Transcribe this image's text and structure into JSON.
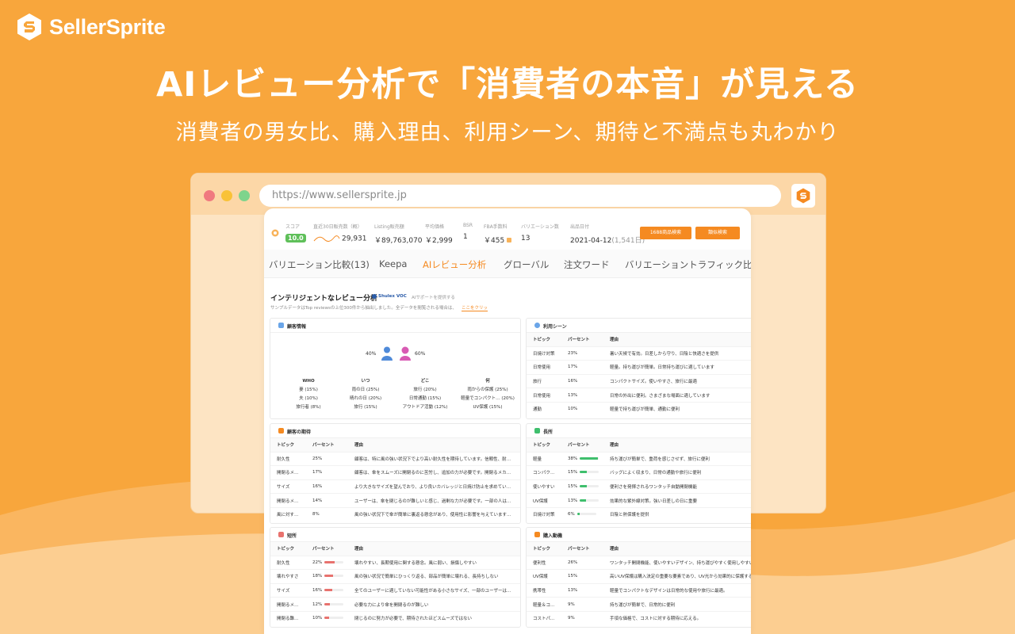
{
  "brand": {
    "name": "SellerSprite"
  },
  "headline": "AIレビュー分析で「消費者の本音」が見える",
  "subline": "消費者の男女比、購入理由、利用シーン、期待と不満点も丸わかり",
  "browser": {
    "url": "https://www.sellersprite.jp"
  },
  "stats": [
    {
      "label": "スコア",
      "value": "10.0"
    },
    {
      "label": "直近30日販売数（概）",
      "value": "29,931"
    },
    {
      "label": "Listing販売額",
      "value": "￥89,763,070"
    },
    {
      "label": "平均価格",
      "value": "￥2,999"
    },
    {
      "label": "BSR",
      "value": "1"
    },
    {
      "label": "FBA手数料",
      "value": "￥455"
    },
    {
      "label": "バリエーション数",
      "value": "13"
    },
    {
      "label": "出品日付",
      "value": "2021-04-12",
      "extra": "(1,541日)"
    }
  ],
  "buttons": {
    "search1688": "1688商品検索",
    "similar": "類似検索"
  },
  "tabs": [
    "バリエーション比較(13)",
    "Keepa",
    "AIレビュー分析",
    "グローバル",
    "注文ワード",
    "バリエーショントラフィック比較"
  ],
  "analysis": {
    "title": "インテリジェントなレビュー分析",
    "voc": "Shulex VOC",
    "voc_sub": "AIサポートを提供する",
    "note": "サンプルデータはTop reviewsの上位300件から抽出しました。全データを閲覧される場合は、",
    "note_link": "ここをクリッ"
  },
  "customer": {
    "title": "顧客情報",
    "male_pct": "40%",
    "female_pct": "60%",
    "columns": [
      {
        "head": "WHO",
        "items": [
          "妻 (15%)",
          "夫 (10%)",
          "旅行者 (8%)"
        ]
      },
      {
        "head": "いつ",
        "items": [
          "雨の日 (25%)",
          "晴れの日 (20%)",
          "旅行 (15%)"
        ]
      },
      {
        "head": "どこ",
        "items": [
          "旅行 (20%)",
          "日常通勤 (15%)",
          "アウトドア活動 (12%)"
        ]
      },
      {
        "head": "何",
        "items": [
          "雨からの保護 (25%)",
          "軽量でコンパクト… (20%)",
          "UV保護 (15%)"
        ]
      }
    ]
  },
  "usage": {
    "title": "利用シーン",
    "headers": [
      "トピック",
      "パーセント",
      "理由"
    ],
    "rows": [
      [
        "日焼け対策",
        "23%",
        "暑い天候で有効。日差しから守り、日陰と快適さを提供"
      ],
      [
        "日常使用",
        "17%",
        "軽量。持ち運びが簡単。日常持ち運びに適しています"
      ],
      [
        "旅行",
        "16%",
        "コンパクトサイズ。使いやすさ、旅行に最適"
      ],
      [
        "日常使用",
        "13%",
        "日常の外出に便利。さまざまな場面に適しています"
      ],
      [
        "通勤",
        "10%",
        "軽量で持ち運びが簡単、通勤に便利"
      ]
    ]
  },
  "expectation": {
    "title": "顧客の期待",
    "headers": [
      "トピック",
      "パーセント",
      "理由"
    ],
    "rows": [
      [
        "耐久性",
        "25%",
        "顧客は、特に風の強い状況下でより高い耐久性を期待しています。信頼性、耐…"
      ],
      [
        "開閉るメ…",
        "17%",
        "顧客は、傘をスムーズに開閉るのに苦労し、追加の力が必要です。開閉るメカ…"
      ],
      [
        "サイズ",
        "16%",
        "より大きなサイズを望んでおり、より良いカバレッジと日焼け防止を求めてい…"
      ],
      [
        "開閉るメ…",
        "14%",
        "ユーザーは、傘を閉じるのが難しいと感じ、過剰な力が必要です。一部の人は…"
      ],
      [
        "風に対す…",
        "8%",
        "風の強い状況下で傘が簡単に裏返る懸念があり、使用性に影響を与えています…"
      ]
    ]
  },
  "strengths": {
    "title": "長所",
    "headers": [
      "トピック",
      "パーセント",
      "理由"
    ],
    "rows": [
      [
        "軽量",
        "38%",
        "持ち運びが簡単で、重荷を感じさせず、旅行に便利"
      ],
      [
        "コンパク…",
        "15%",
        "バッグによく収まり、日常の通勤や旅行に便利"
      ],
      [
        "使いやすい",
        "15%",
        "便利さを発揮されるワンタッチ自動開閉機能"
      ],
      [
        "UV保護",
        "13%",
        "効果的な紫外線対策。強い日差しの日に重要"
      ],
      [
        "日焼け対策",
        "6%",
        "日陰と熱保護を提供"
      ]
    ],
    "bars": [
      0.38,
      0.15,
      0.15,
      0.13,
      0.06
    ],
    "color": "#3fbf6d"
  },
  "weaknesses": {
    "title": "短所",
    "headers": [
      "トピック",
      "パーセント",
      "理由"
    ],
    "rows": [
      [
        "耐久性",
        "22%",
        "壊れやすい、長期使用に関する懸念。風に弱い、損傷しやすい"
      ],
      [
        "壊れやすさ",
        "18%",
        "風の強い状況で簡単にひっくり返る、部品が簡単に壊れる、長持ちしない"
      ],
      [
        "サイズ",
        "16%",
        "全てのユーザーに適していない可能性がある小さなサイズ、一部のユーザーは…"
      ],
      [
        "開閉るメ…",
        "12%",
        "必要な力により傘を開閉るのが難しい"
      ],
      [
        "開閉る難…",
        "10%",
        "閉じるのに努力が必要で、期待されたほどスムーズではない"
      ]
    ],
    "bars": [
      0.22,
      0.18,
      0.16,
      0.12,
      0.1
    ],
    "color": "#e8726e"
  },
  "purchase": {
    "title": "購入動機",
    "headers": [
      "トピック",
      "パーセント",
      "理由"
    ],
    "rows": [
      [
        "便利性",
        "26%",
        "ワンタッチ開閉機能、使いやすいデザイン、持ち運びやすく使用しやすい"
      ],
      [
        "UV保護",
        "15%",
        "高いUV保護は購入決定の重要な要素であり、UV光から効果的に保護する"
      ],
      [
        "携帯性",
        "13%",
        "軽量でコンパクトなデザインは日常的な使用や旅行に最適。"
      ],
      [
        "軽量＆コ…",
        "9%",
        "持ち運びが簡単で、日常的に便利"
      ],
      [
        "コストパ…",
        "9%",
        "手頃な価格で、コストに対する期待に応える。"
      ]
    ]
  }
}
